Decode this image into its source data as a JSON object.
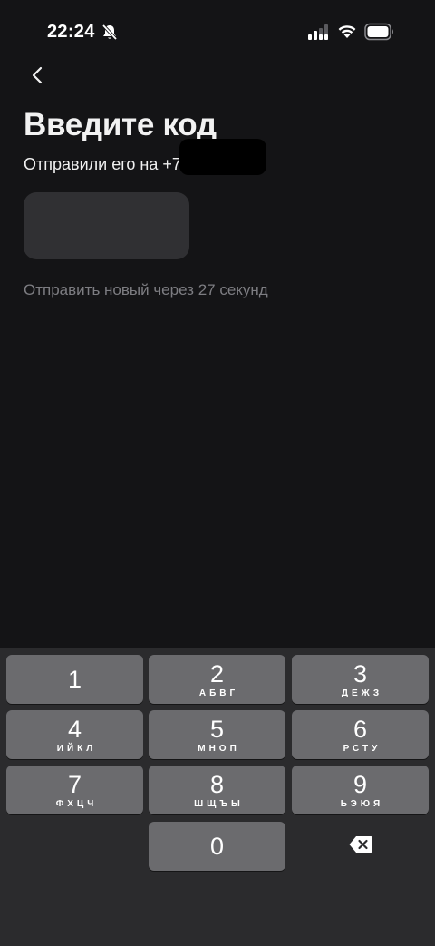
{
  "status_bar": {
    "time": "22:24",
    "icons": [
      "bell-slash-icon",
      "cellular-signal-icon",
      "wifi-icon",
      "battery-icon"
    ]
  },
  "header": {
    "back_icon": "chevron-left-icon"
  },
  "main": {
    "title": "Введите код",
    "subtitle": "Отправили его на +79",
    "resend_text": "Отправить новый через 27 секунд"
  },
  "keypad": {
    "keys": [
      {
        "digit": "1",
        "letters": ""
      },
      {
        "digit": "2",
        "letters": "АБВГ"
      },
      {
        "digit": "3",
        "letters": "ДЕЖЗ"
      },
      {
        "digit": "4",
        "letters": "ИЙКЛ"
      },
      {
        "digit": "5",
        "letters": "МНОП"
      },
      {
        "digit": "6",
        "letters": "РСТУ"
      },
      {
        "digit": "7",
        "letters": "ФХЦЧ"
      },
      {
        "digit": "8",
        "letters": "ШЩЪЫ"
      },
      {
        "digit": "9",
        "letters": "ЬЭЮЯ"
      },
      {
        "digit": "0",
        "letters": ""
      }
    ],
    "delete_icon": "backspace-icon"
  },
  "colors": {
    "background": "#141416",
    "code_field": "#303033",
    "keyboard": "#2b2b2d",
    "key": "#6b6b6e",
    "muted_text": "#7d7d82"
  }
}
